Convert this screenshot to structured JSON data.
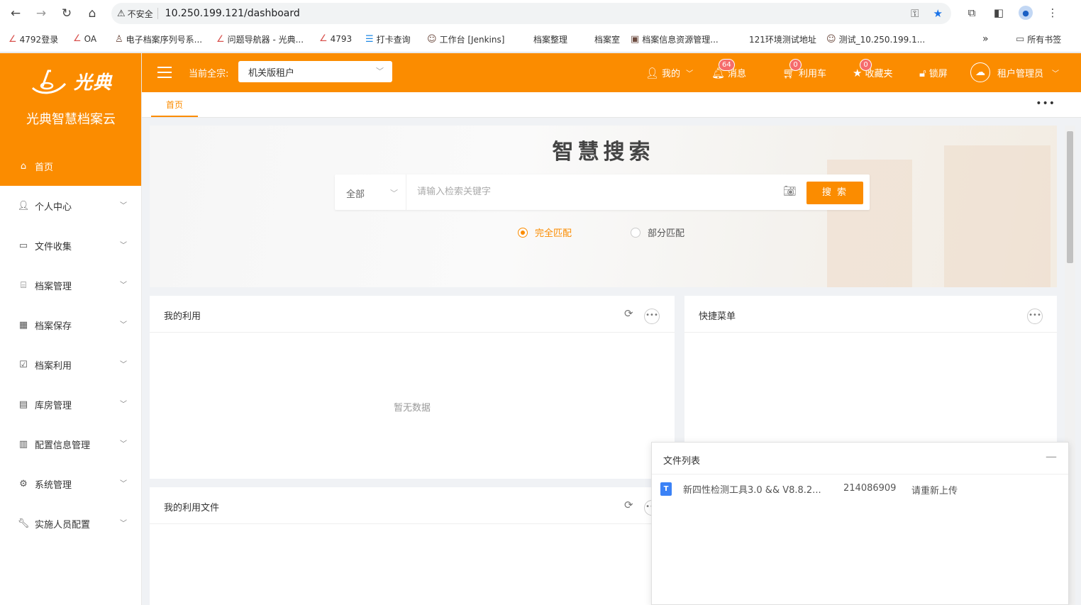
{
  "browser": {
    "security_label": "不安全",
    "url": "10.250.199.121/dashboard",
    "bookmarks": [
      "4792登录",
      "OA",
      "电子档案序列号系...",
      "问题导航器 - 光典...",
      "4793",
      "打卡查询",
      "工作台 [Jenkins]",
      "档案整理",
      "档案室",
      "档案信息资源管理...",
      "121环境测试地址",
      "测试_10.250.199.1...",
      "所有书签"
    ]
  },
  "sidebar": {
    "logo_text": "光典",
    "subtitle": "光典智慧档案云",
    "items": [
      {
        "label": "首页",
        "icon": "home-icon"
      },
      {
        "label": "个人中心",
        "icon": "user-icon"
      },
      {
        "label": "文件收集",
        "icon": "briefcase-icon"
      },
      {
        "label": "档案管理",
        "icon": "bank-icon"
      },
      {
        "label": "档案保存",
        "icon": "building-icon"
      },
      {
        "label": "档案利用",
        "icon": "clipboard-check-icon"
      },
      {
        "label": "库房管理",
        "icon": "warehouse-icon"
      },
      {
        "label": "配置信息管理",
        "icon": "clipboard-icon"
      },
      {
        "label": "系统管理",
        "icon": "gear-icon"
      },
      {
        "label": "实施人员配置",
        "icon": "wrench-icon"
      }
    ]
  },
  "header": {
    "tenant_label": "当前全宗:",
    "tenant_value": "机关版租户",
    "mine": "我的",
    "messages": "消息",
    "messages_count": "64",
    "cart": "利用车",
    "cart_count": "0",
    "favorites": "收藏夹",
    "favorites_count": "0",
    "lock": "锁屏",
    "user": "租户管理员"
  },
  "tabs": {
    "home": "首页"
  },
  "search": {
    "title": "智慧搜索",
    "scope": "全部",
    "placeholder": "请输入检索关键字",
    "button": "搜 索",
    "match_full": "完全匹配",
    "match_partial": "部分匹配"
  },
  "cards": {
    "my_usage": {
      "title": "我的利用",
      "empty": "暂无数据"
    },
    "quick_menu": {
      "title": "快捷菜单"
    },
    "my_usage_files": {
      "title": "我的利用文件"
    }
  },
  "file_panel": {
    "title": "文件列表",
    "file_name": "新四性检测工具3.0 && V8.8.2...",
    "file_size": "214086909",
    "file_status": "请重新上传"
  },
  "colors": {
    "accent": "#fb8c00",
    "badge": "#f56c6c"
  }
}
